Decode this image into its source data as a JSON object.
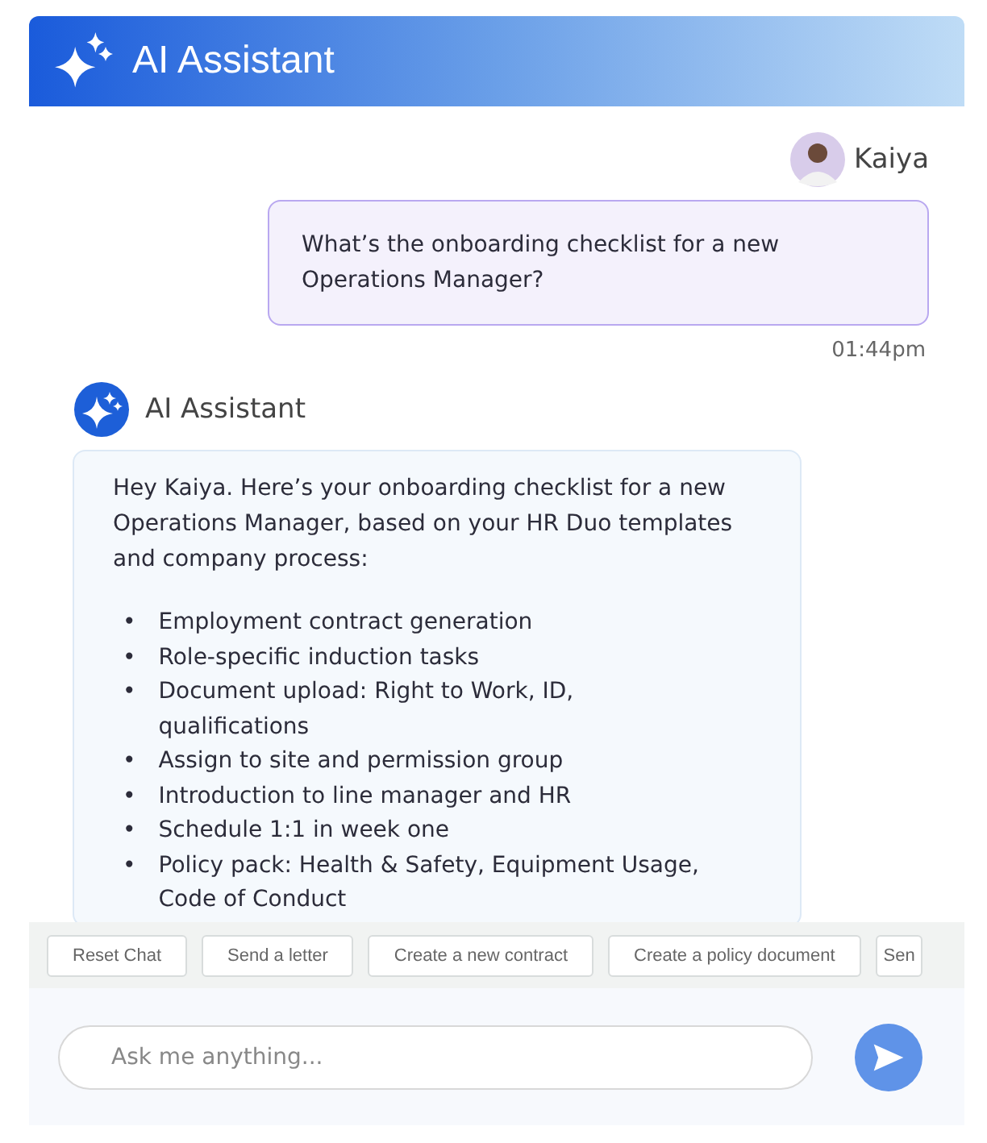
{
  "header": {
    "title": "AI Assistant"
  },
  "user_message": {
    "sender": "Kaiya",
    "text": "What’s the onboarding checklist for a new Operations Manager?",
    "time": "01:44pm"
  },
  "assistant_message": {
    "sender": "AI Assistant",
    "intro": "Hey Kaiya. Here’s your onboarding checklist for a new Operations Manager, based on your HR Duo templates and company process:",
    "items": [
      {
        "marker": "•",
        "text": "Employment contract generation"
      },
      {
        "marker": "•",
        "text": "Role-specific induction tasks"
      },
      {
        "marker": "•",
        "text": "Document upload: Right to Work, ID, qualifications"
      },
      {
        "marker": "•",
        "text": "Assign to site and permission group"
      },
      {
        "marker": "•",
        "text": "Introduction to line manager and HR"
      },
      {
        "marker": "•",
        "text": "Schedule 1:1 in week one"
      },
      {
        "marker": "•",
        "text": "Policy pack: Health & Safety, Equipment Usage, Code of Conduct"
      }
    ]
  },
  "quick_actions": [
    "Reset Chat",
    "Send a letter",
    "Create a new contract",
    "Create a policy document",
    "Sen"
  ],
  "composer": {
    "placeholder": "Ask me anything..."
  }
}
